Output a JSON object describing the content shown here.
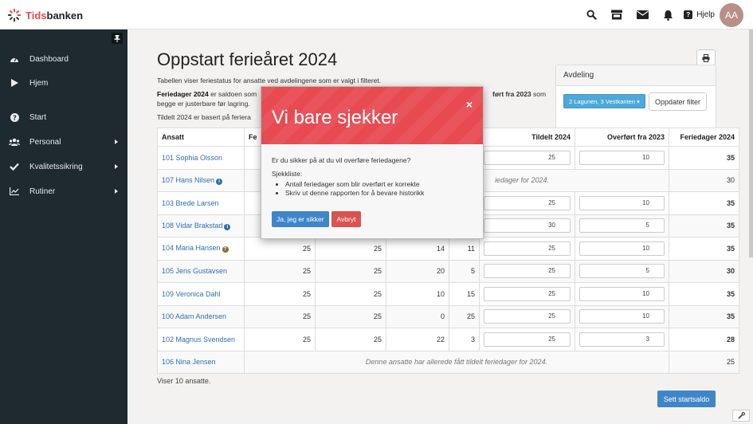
{
  "brand": {
    "name_prefix": "Tids",
    "name_suffix": "banken"
  },
  "topbar": {
    "icons": [
      "search-icon",
      "store-icon",
      "envelope-icon",
      "bell-icon"
    ],
    "help_label": "Hjelp",
    "avatar_initials": "AA"
  },
  "sidebar": {
    "items": [
      {
        "label": "Dashboard",
        "icon": "dashboard-icon",
        "submenu": false
      },
      {
        "label": "Hjem",
        "icon": "play-icon",
        "submenu": false
      },
      {
        "label": "Start",
        "icon": "question-circle-icon",
        "submenu": false
      },
      {
        "label": "Personal",
        "icon": "users-icon",
        "submenu": true
      },
      {
        "label": "Kvalitetssikring",
        "icon": "check-icon",
        "submenu": true
      },
      {
        "label": "Rutiner",
        "icon": "chart-icon",
        "submenu": true
      }
    ]
  },
  "page": {
    "title": "Oppstart ferieåret 2024",
    "intro_1": "Tabellen viser feriestatus for ansatte ved avdelingene som er valgt i filteret.",
    "intro_2_bold": "Feriedager 2024",
    "intro_2_rest": "er saldoen som",
    "intro_2_line2": "begge er justerbare før lagring.",
    "intro_right_bold": "ført fra 2023",
    "intro_right_rest": "som",
    "intro_3": "Tildelt 2024 er basert på feriera",
    "count_text": "Viser 10 ansatte.",
    "set_button": "Sett startsaldo"
  },
  "filter": {
    "header": "Avdeling",
    "department_button": "2 Lagunen, 3 Vestkanten ▾",
    "update_button": "Oppdater filter"
  },
  "table": {
    "headers": [
      "Ansatt",
      "Fe",
      "",
      "",
      "",
      "Tildelt 2024",
      "Overført fra 2023",
      "Feriedager 2024"
    ],
    "rows": [
      {
        "name": "101 Sophia Olsson",
        "info": "",
        "cols": [
          "",
          "",
          "",
          ""
        ],
        "tildelt": "25",
        "overfort": "10",
        "total": "35",
        "note": ""
      },
      {
        "name": "107 Hans Nilsen",
        "info": "i",
        "cols": [],
        "tildelt": "",
        "overfort": "",
        "total": "30",
        "note": "iedager for 2024."
      },
      {
        "name": "103 Brede Larsen",
        "info": "",
        "cols": [
          "",
          "",
          "",
          ""
        ],
        "tildelt": "25",
        "overfort": "10",
        "total": "35",
        "note": ""
      },
      {
        "name": "108 Vidar Brakstad",
        "info": "i",
        "cols": [
          "",
          "",
          "",
          ""
        ],
        "tildelt": "30",
        "overfort": "5",
        "total": "35",
        "note": ""
      },
      {
        "name": "104 Maria Hansen",
        "info": "?",
        "cols": [
          "25",
          "25",
          "14",
          "11"
        ],
        "tildelt": "25",
        "overfort": "10",
        "total": "35",
        "note": ""
      },
      {
        "name": "105 Jens Gustavsen",
        "info": "",
        "cols": [
          "25",
          "25",
          "20",
          "5"
        ],
        "tildelt": "25",
        "overfort": "5",
        "total": "30",
        "note": ""
      },
      {
        "name": "109 Veronica Dahl",
        "info": "",
        "cols": [
          "25",
          "25",
          "10",
          "15"
        ],
        "tildelt": "25",
        "overfort": "10",
        "total": "35",
        "note": ""
      },
      {
        "name": "100 Adam Andersen",
        "info": "",
        "cols": [
          "25",
          "25",
          "0",
          "25"
        ],
        "tildelt": "25",
        "overfort": "10",
        "total": "35",
        "note": ""
      },
      {
        "name": "102 Magnus Svendsen",
        "info": "",
        "cols": [
          "25",
          "25",
          "22",
          "3"
        ],
        "tildelt": "25",
        "overfort": "3",
        "total": "28",
        "note": ""
      },
      {
        "name": "106 Nina Jensen",
        "info": "",
        "cols": [],
        "tildelt": "",
        "overfort": "",
        "total": "25",
        "note": "Denne ansatte har allerede fått tildelt feriedager for 2024."
      }
    ]
  },
  "modal": {
    "title": "Vi bare sjekker",
    "close": "×",
    "question": "Er du sikker på at du vil overføre feriedagene?",
    "checklist_label": "Sjekkliste:",
    "checklist": [
      "Antall feriedager som blir overført er korrekte",
      "Skriv ut denne rapporten for å bevare historikk"
    ],
    "confirm_button": "Ja, jeg er sikker",
    "cancel_button": "Avbryt",
    "header_color": "#e84a52"
  }
}
